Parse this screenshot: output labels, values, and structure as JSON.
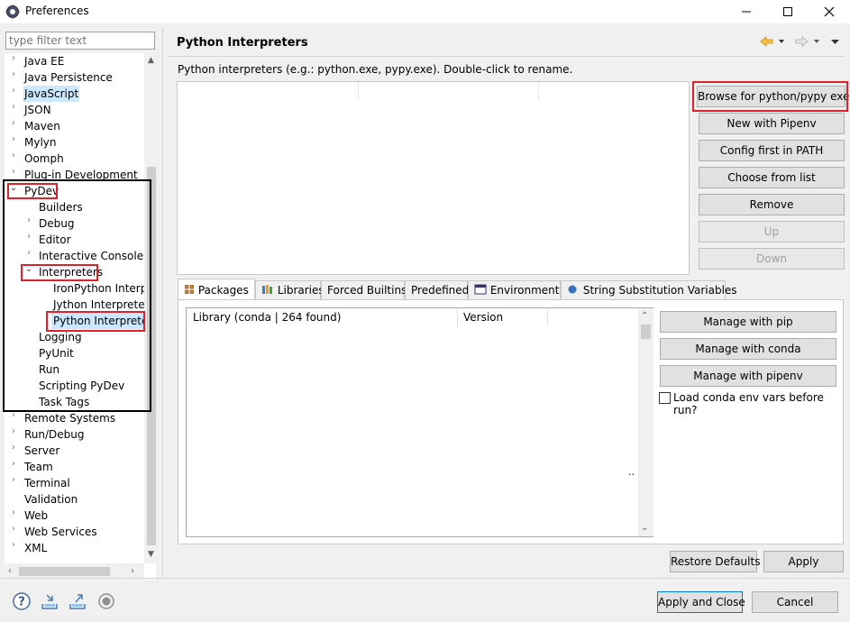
{
  "window": {
    "title": "Preferences",
    "minimize": "—",
    "maximize": "☐",
    "close": "✕"
  },
  "filter": {
    "placeholder": "type filter text"
  },
  "tree": {
    "items": [
      {
        "label": "Java EE"
      },
      {
        "label": "Java Persistence"
      },
      {
        "label": "JavaScript"
      },
      {
        "label": "JSON"
      },
      {
        "label": "Maven"
      },
      {
        "label": "Mylyn"
      },
      {
        "label": "Oomph"
      },
      {
        "label": "Plug-in Development"
      },
      {
        "label": "PyDev"
      },
      {
        "label": "Builders"
      },
      {
        "label": "Debug"
      },
      {
        "label": "Editor"
      },
      {
        "label": "Interactive Console"
      },
      {
        "label": "Interpreters"
      },
      {
        "label": "IronPython Interpreter"
      },
      {
        "label": "Jython Interpreter"
      },
      {
        "label": "Python Interpreter"
      },
      {
        "label": "Logging"
      },
      {
        "label": "PyUnit"
      },
      {
        "label": "Run"
      },
      {
        "label": "Scripting PyDev"
      },
      {
        "label": "Task Tags"
      },
      {
        "label": "Remote Systems"
      },
      {
        "label": "Run/Debug"
      },
      {
        "label": "Server"
      },
      {
        "label": "Team"
      },
      {
        "label": "Terminal"
      },
      {
        "label": "Validation"
      },
      {
        "label": "Web"
      },
      {
        "label": "Web Services"
      },
      {
        "label": "XML"
      }
    ]
  },
  "page": {
    "title": "Python Interpreters",
    "description": "Python interpreters (e.g.: python.exe, pypy.exe).   Double-click to rename."
  },
  "interpreter_buttons": {
    "browse": "Browse for python/pypy exe",
    "pipenv": "New with Pipenv",
    "config_path": "Config first in PATH",
    "choose_list": "Choose from list",
    "remove": "Remove",
    "up": "Up",
    "down": "Down"
  },
  "tabs": [
    {
      "label": "Packages"
    },
    {
      "label": "Libraries"
    },
    {
      "label": "Forced Builtins"
    },
    {
      "label": "Predefined"
    },
    {
      "label": "Environment"
    },
    {
      "label": "String Substitution Variables"
    }
  ],
  "packages": {
    "col_library": "Library (conda | 264 found)",
    "col_version": "Version",
    "ellipsis": ".."
  },
  "package_buttons": {
    "pip": "Manage with pip",
    "conda": "Manage with conda",
    "pipenv": "Manage with pipenv",
    "load_conda_label": "Load conda env vars before run?"
  },
  "footer": {
    "restore_defaults": "Restore Defaults",
    "apply": "Apply",
    "apply_close": "Apply and Close",
    "cancel": "Cancel"
  },
  "colors": {
    "highlight_red": "#e0202a",
    "selection": "#cce8ff",
    "accent": "#0078d7"
  }
}
